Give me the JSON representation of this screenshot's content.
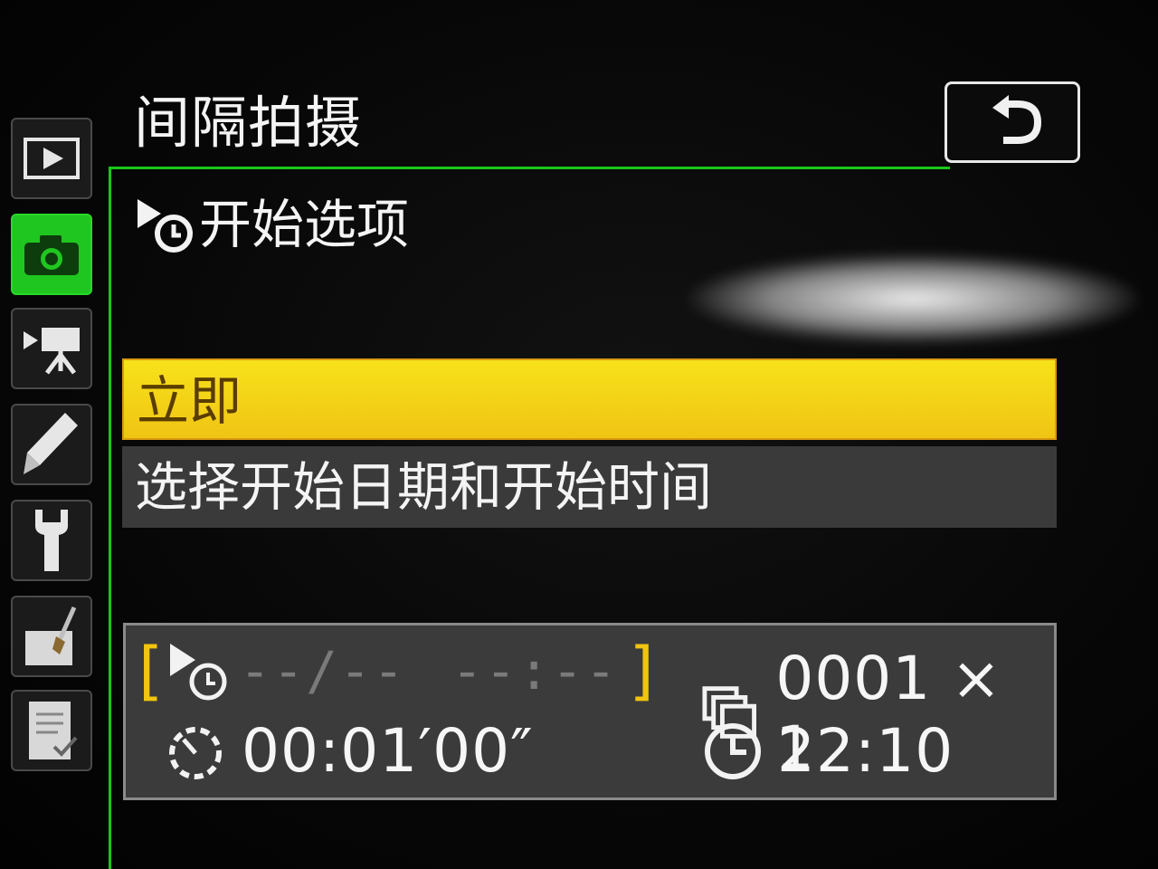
{
  "menu": {
    "title": "间隔拍摄",
    "back_icon": "return-arrow-icon",
    "subheading": "开始选项",
    "options": [
      {
        "label": "立即",
        "selected": true
      },
      {
        "label": "选择开始日期和开始时间",
        "selected": false
      }
    ]
  },
  "tabs": [
    {
      "name": "playback-menu",
      "icon": "play-icon"
    },
    {
      "name": "shooting-menu",
      "icon": "camera-icon",
      "active": true
    },
    {
      "name": "movie-menu",
      "icon": "movie-camera-icon"
    },
    {
      "name": "custom-settings-menu",
      "icon": "pencil-icon"
    },
    {
      "name": "setup-menu",
      "icon": "wrench-icon"
    },
    {
      "name": "retouch-menu",
      "icon": "retouch-brush-icon"
    },
    {
      "name": "my-menu",
      "icon": "checklist-icon"
    }
  ],
  "summary": {
    "start_date": "--/--",
    "start_time": "--:--",
    "interval": "00:01′00″",
    "shots": "0001 × 1",
    "clock": "22:10"
  },
  "colors": {
    "accent_green": "#1fc61f",
    "highlight_yellow": "#f5d816",
    "bracket_yellow": "#f1c40f"
  }
}
